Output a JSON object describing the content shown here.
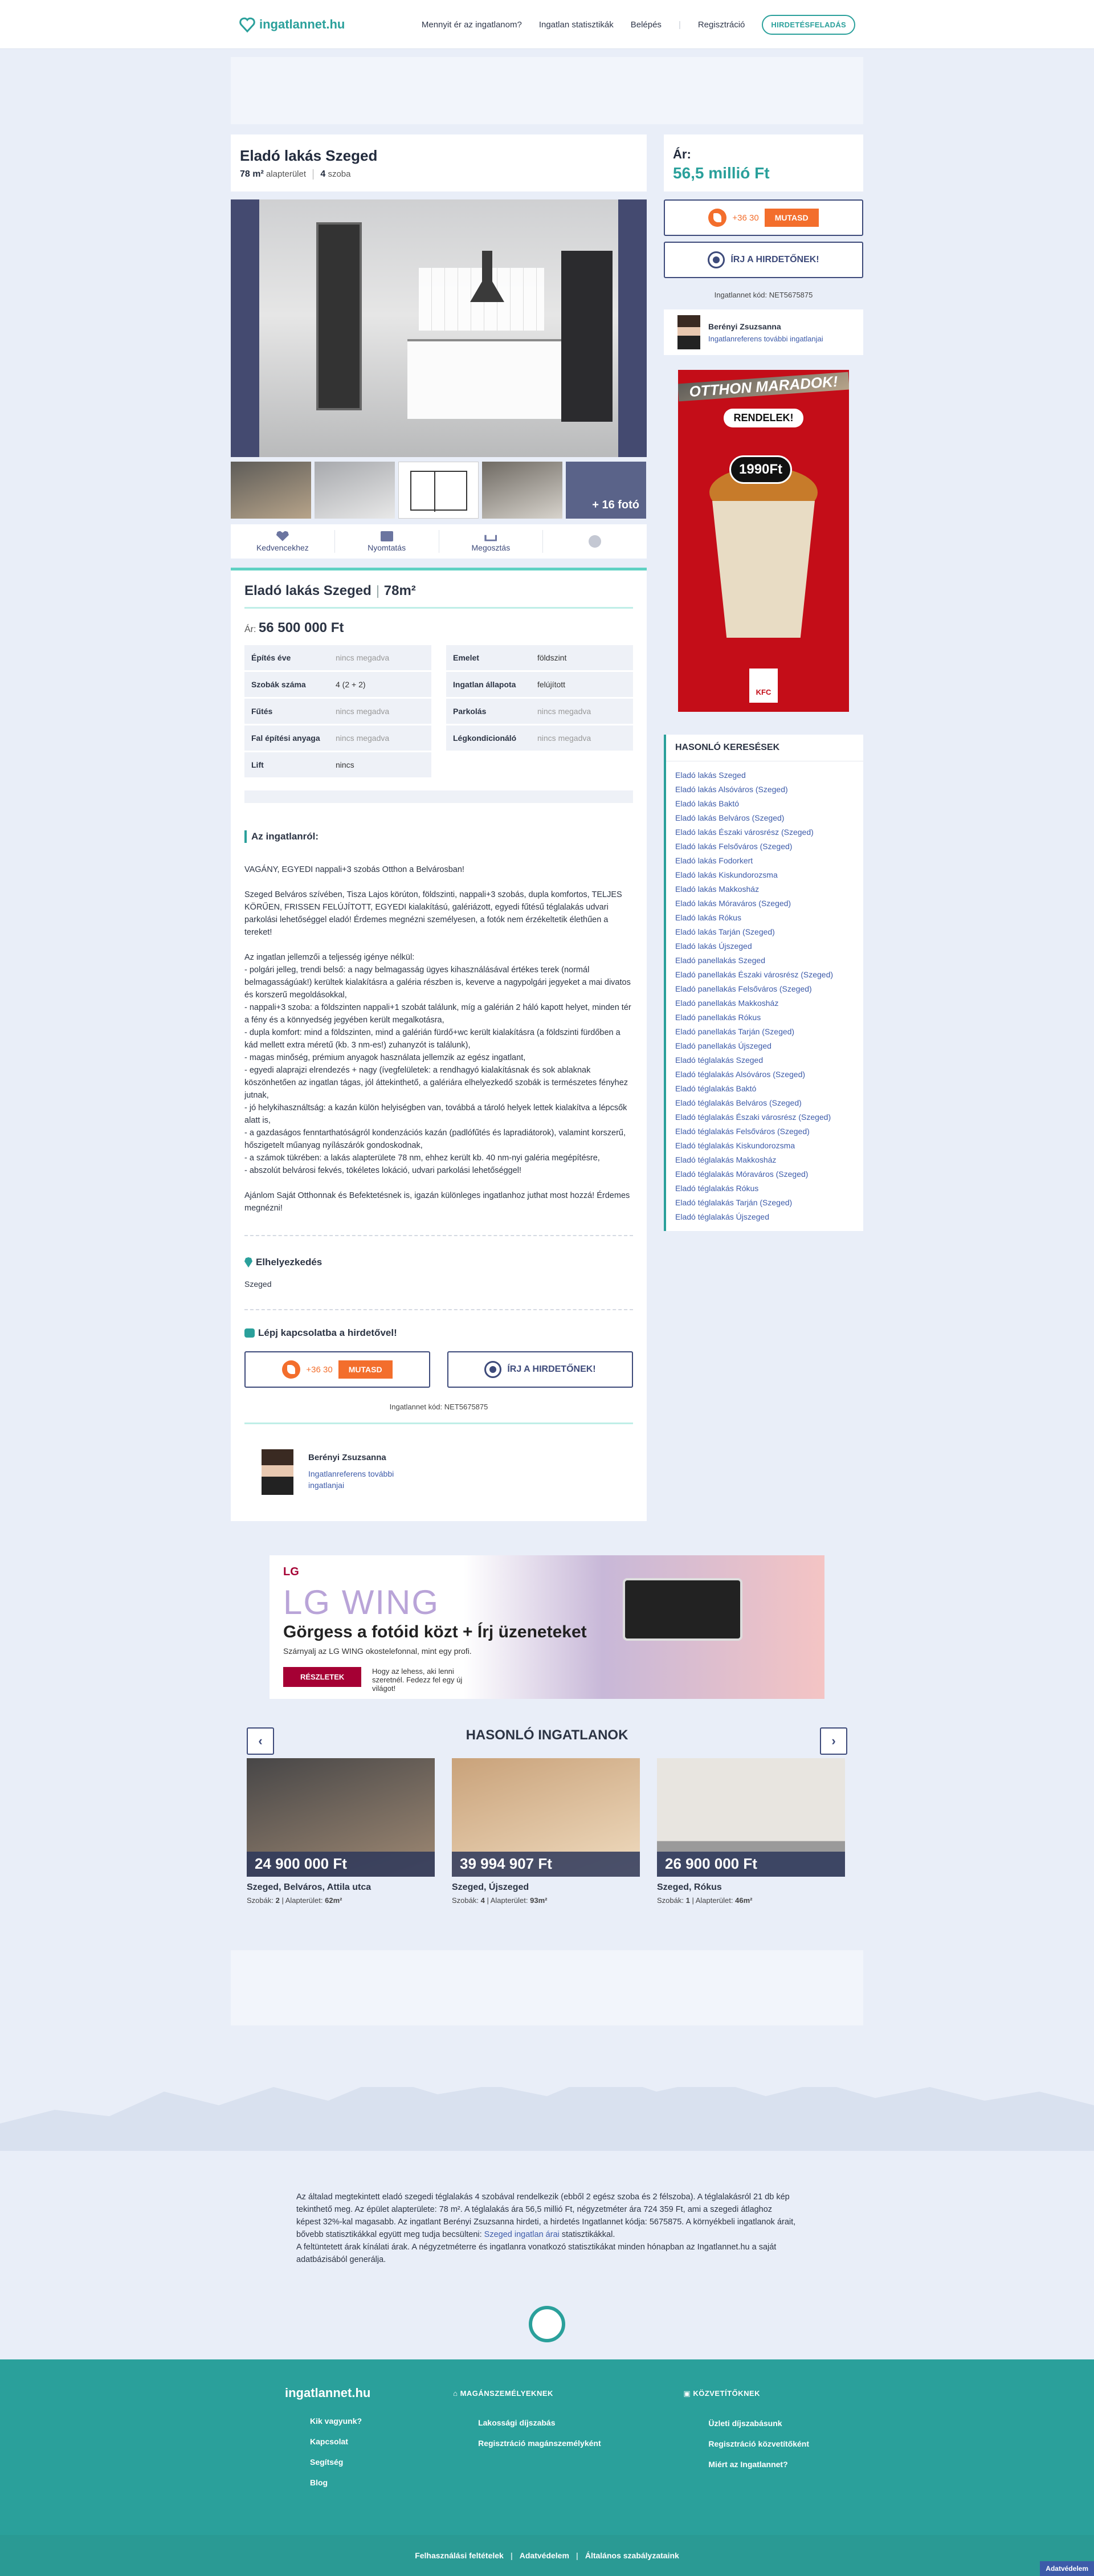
{
  "header": {
    "logo": "ingatlannet.hu",
    "nav": [
      "Mennyit ér az ingatlanom?",
      "Ingatlan statisztikák",
      "Belépés",
      "Regisztráció"
    ],
    "cta": "HIRDETÉSFELADÁS"
  },
  "listing": {
    "title": "Eladó lakás Szeged",
    "area": "78 m²",
    "area_label": "alapterület",
    "rooms": "4",
    "rooms_label": "szoba",
    "price_label": "Ár:",
    "price": "56,5 millió Ft",
    "more_photos": "+ 16 fotó"
  },
  "actions": [
    "Kedvencekhez",
    "Nyomtatás",
    "Megosztás"
  ],
  "details": {
    "title": "Eladó lakás Szeged",
    "size": "78m²",
    "price_prefix": "Ár:",
    "price": "56 500 000 Ft",
    "left": [
      {
        "k": "Építés éve",
        "v": "nincs megadva"
      },
      {
        "k": "Szobák száma",
        "v": "4 (2 + 2)"
      },
      {
        "k": "Fűtés",
        "v": "nincs megadva"
      },
      {
        "k": "Fal építési anyaga",
        "v": "nincs megadva"
      },
      {
        "k": "Lift",
        "v": "nincs"
      }
    ],
    "right": [
      {
        "k": "Emelet",
        "v": "földszint"
      },
      {
        "k": "Ingatlan állapota",
        "v": "felújított"
      },
      {
        "k": "Parkolás",
        "v": "nincs megadva"
      },
      {
        "k": "Légkondicionáló",
        "v": "nincs megadva"
      }
    ],
    "about_title": "Az ingatlanról:",
    "description": "VAGÁNY, EGYEDI nappali+3 szobás Otthon a Belvárosban!\n\nSzeged Belváros szívében, Tisza Lajos körúton, földszinti, nappali+3 szobás, dupla komfortos, TELJES KÖRŰEN, FRISSEN FELÚJÍTOTT, EGYEDI kialakítású, galériázott, egyedi fűtésű téglalakás udvari parkolási lehetőséggel eladó! Érdemes megnézni személyesen, a fotók nem érzékeltetik élethűen a tereket!\n\nAz ingatlan jellemzői a teljesség igénye nélkül:\n- polgári jelleg, trendi belső: a nagy belmagasság ügyes kihasználásával értékes terek (normál belmagasságúak!) kerültek kialakításra a galéria részben is, keverve a nagypolgári jegyeket a mai divatos és korszerű megoldásokkal,\n- nappali+3 szoba: a földszinten nappali+1 szobát találunk, míg a galérián 2 háló kapott helyet, minden tér a fény és a könnyedség jegyében került megalkotásra,\n- dupla komfort: mind a földszinten, mind a galérián fürdő+wc került kialakításra (a földszinti fürdőben a kád mellett extra méretű (kb. 3 nm-es!) zuhanyzót is találunk),\n- magas minőség, prémium anyagok használata jellemzik az egész ingatlant,\n- egyedi alaprajzi elrendezés + nagy (ívegfelületek: a rendhagyó kialakításnak és sok ablaknak köszönhetően az ingatlan tágas, jól áttekinthető, a galériára elhelyezkedő szobák is természetes fényhez jutnak,\n- jó helykihasználtság: a kazán külön helyiségben van, továbbá a tároló helyek lettek kialakítva a lépcsők alatt is,\n- a gazdaságos fenntarthatóságról kondenzációs kazán (padlófűtés és lapradiátorok), valamint korszerű, hőszigetelt műanyag nyílászárók gondoskodnak,\n- a számok tükrében: a lakás alapterülete 78 nm, ehhez került kb. 40 nm-nyi galéria megépítésre,\n- abszolút belvárosi fekvés, tökéletes lokáció, udvari parkolási lehetőséggel!\n\nAjánlom Saját Otthonnak és Befektetésnek is, igazán különleges ingatlanhoz juthat most hozzá! Érdemes megnézni!",
    "location_title": "Elhelyezkedés",
    "location": "Szeged",
    "contact_title": "Lépj kapcsolatba a hirdetővel!"
  },
  "contact": {
    "phone": "+36 30",
    "show": "MUTASD",
    "write": "ÍRJ A HIRDETŐNEK!",
    "code": "Ingatlannet kód: NET5675875"
  },
  "agent": {
    "name": "Berényi Zsuzsanna",
    "link": "Ingatlanreferens további ingatlanjai"
  },
  "ad_kfc": {
    "headline": "OTTHON MARADOK!",
    "order": "RENDELEK!",
    "price": "1990Ft",
    "brand": "KFC"
  },
  "similar_searches": {
    "title": "HASONLÓ KERESÉSEK",
    "items": [
      "Eladó lakás Szeged",
      "Eladó lakás Alsóváros (Szeged)",
      "Eladó lakás Baktó",
      "Eladó lakás Belváros (Szeged)",
      "Eladó lakás Északi városrész (Szeged)",
      "Eladó lakás Felsőváros (Szeged)",
      "Eladó lakás Fodorkert",
      "Eladó lakás Kiskundorozsma",
      "Eladó lakás Makkosház",
      "Eladó lakás Móraváros (Szeged)",
      "Eladó lakás Rókus",
      "Eladó lakás Tarján (Szeged)",
      "Eladó lakás Újszeged",
      "Eladó panellakás Szeged",
      "Eladó panellakás Északi városrész (Szeged)",
      "Eladó panellakás Felsőváros (Szeged)",
      "Eladó panellakás Makkosház",
      "Eladó panellakás Rókus",
      "Eladó panellakás Tarján (Szeged)",
      "Eladó panellakás Újszeged",
      "Eladó téglalakás Szeged",
      "Eladó téglalakás Alsóváros (Szeged)",
      "Eladó téglalakás Baktó",
      "Eladó téglalakás Belváros (Szeged)",
      "Eladó téglalakás Északi városrész (Szeged)",
      "Eladó téglalakás Felsőváros (Szeged)",
      "Eladó téglalakás Kiskundorozsma",
      "Eladó téglalakás Makkosház",
      "Eladó téglalakás Móraváros (Szeged)",
      "Eladó téglalakás Rókus",
      "Eladó téglalakás Tarján (Szeged)",
      "Eladó téglalakás Újszeged"
    ]
  },
  "ad_lg": {
    "brand": "LG",
    "product": "LG WING",
    "headline": "Görgess a fotóid közt + Írj üzeneteket",
    "sub": "Szárnyalj az LG WING okostelefonnal, mint egy profi.",
    "button": "RÉSZLETEK",
    "small": "Hogy az lehess, aki lenni szeretnél. Fedezz fel egy új világot!"
  },
  "similar_props": {
    "title": "HASONLÓ INGATLANOK",
    "cards": [
      {
        "price": "24 900 000 Ft",
        "location": "Szeged, Belváros, Attila utca",
        "rooms_label": "Szobák:",
        "rooms": "2",
        "area_label": "Alapterület:",
        "area": "62m²"
      },
      {
        "price": "39 994 907 Ft",
        "location": "Szeged, Újszeged",
        "rooms_label": "Szobák:",
        "rooms": "4",
        "area_label": "Alapterület:",
        "area": "93m²"
      },
      {
        "price": "26 900 000 Ft",
        "location": "Szeged, Rókus",
        "rooms_label": "Szobák:",
        "rooms": "1",
        "area_label": "Alapterület:",
        "area": "46m²"
      }
    ]
  },
  "seo": {
    "text": "Az általad megtekintett eladó szegedi téglalakás 4 szobával rendelkezik (ebből 2 egész szoba és 2 félszoba). A téglalakásról 21 db kép tekinthető meg. Az épület alapterülete: 78 m². A téglalakás ára 56,5 millió Ft, négyzetméter ára 724 359 Ft, ami a szegedi átlaghoz képest 32%-kal magasabb. Az ingatlant Berényi Zsuzsanna hirdeti, a hirdetés Ingatlannet kódja: 5675875. A környékbeli ingatlanok árait, bővebb statisztikákkal együtt meg tudja becsülteni: ",
    "link": "Szeged ingatlan árai",
    "text2": " statisztikákkal.\nA feltüntetett árak kínálati árak. A négyzetméterre és ingatlanra vonatkozó statisztikákat minden hónapban az Ingatlannet.hu a saját adatbázisából generálja."
  },
  "footer": {
    "logo": "ingatlannet.hu",
    "col1": [
      "Kik vagyunk?",
      "Kapcsolat",
      "Segítség",
      "Blog"
    ],
    "col2_title": "MAGÁNSZEMÉLYEKNEK",
    "col2": [
      "Lakossági díjszabás",
      "Regisztráció magánszemélyként"
    ],
    "col3_title": "KÖZVETÍTŐKNEK",
    "col3": [
      "Üzleti díjszabásunk",
      "Regisztráció közvetítőként",
      "Miért az Ingatlannet?"
    ],
    "bottom": [
      "Felhasználási feltételek",
      "Adatvédelem",
      "Általános szabályzataink"
    ],
    "privacy": "Adatvédelem"
  }
}
